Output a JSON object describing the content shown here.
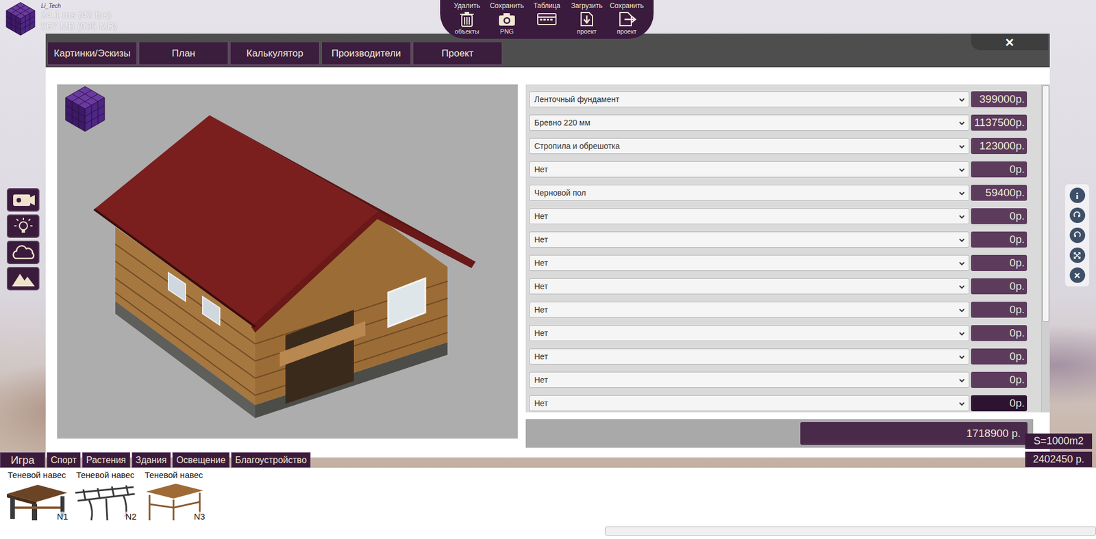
{
  "hud": {
    "brand": "Li_Tech",
    "frame_time": "24.1 ms (42 fps)",
    "memory": "567 MB (905 MB)"
  },
  "toolbar": [
    {
      "label": "Удалить",
      "caption": "объекты"
    },
    {
      "label": "Сохранить",
      "caption": "PNG"
    },
    {
      "label": "Таблица"
    },
    {
      "label": "Загрузить",
      "caption": "проект"
    },
    {
      "label": "Сохранить",
      "caption": "проект"
    }
  ],
  "dialog": {
    "tabs": [
      {
        "label": "Картинки/Эскизы",
        "selected": false
      },
      {
        "label": "План",
        "selected": false
      },
      {
        "label": "Калькулятор",
        "selected": false
      },
      {
        "label": "Производители",
        "selected": false
      },
      {
        "label": "Проект",
        "selected": false
      }
    ],
    "close": "×",
    "estimate": {
      "rows": [
        {
          "item": "Ленточный фундамент",
          "price": "399000р.",
          "focused": false
        },
        {
          "item": "Бревно 220 мм",
          "price": "1137500р.",
          "focused": false
        },
        {
          "item": "Стропила и обрешотка",
          "price": "123000р.",
          "focused": false
        },
        {
          "item": "Нет",
          "price": "0р.",
          "focused": false
        },
        {
          "item": "Черновой пол",
          "price": "59400р.",
          "focused": false
        },
        {
          "item": "Нет",
          "price": "0р.",
          "focused": false
        },
        {
          "item": "Нет",
          "price": "0р.",
          "focused": false
        },
        {
          "item": "Нет",
          "price": "0р.",
          "focused": false
        },
        {
          "item": "Нет",
          "price": "0р.",
          "focused": false
        },
        {
          "item": "Нет",
          "price": "0р.",
          "focused": false
        },
        {
          "item": "Нет",
          "price": "0р.",
          "focused": false
        },
        {
          "item": "Нет",
          "price": "0р.",
          "focused": false
        },
        {
          "item": "Нет",
          "price": "0р.",
          "focused": false
        },
        {
          "item": "Нет",
          "price": "0р.",
          "focused": true
        }
      ],
      "total": "1718900 р."
    }
  },
  "categories": [
    "Игра",
    "Спорт",
    "Растения",
    "Здания",
    "Освещение",
    "Благоустройство"
  ],
  "area": "S=1000m2",
  "grand_total": "2402450 р.",
  "catalog": [
    {
      "title": "Теневой навес",
      "number": "N1"
    },
    {
      "title": "Теневой навес",
      "number": "N2"
    },
    {
      "title": "Теневой навес",
      "number": "N3"
    }
  ]
}
